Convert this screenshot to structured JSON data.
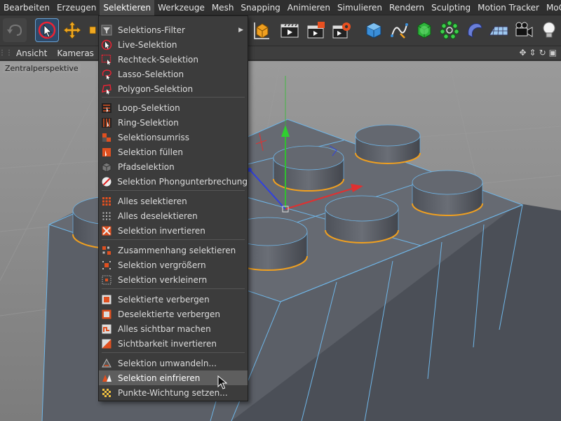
{
  "menubar": {
    "items": [
      "Bearbeiten",
      "Erzeugen",
      "Selektieren",
      "Werkzeuge",
      "Mesh",
      "Snapping",
      "Animieren",
      "Simulieren",
      "Rendern",
      "Sculpting",
      "Motion Tracker",
      "MoGraph"
    ],
    "active": "Selektieren"
  },
  "viewport": {
    "menus": [
      "Ansicht",
      "Kameras"
    ],
    "camera_label": "Zentralperspektive"
  },
  "dropdown": {
    "groups": [
      [
        "Selektions-Filter",
        "Live-Selektion",
        "Rechteck-Selektion",
        "Lasso-Selektion",
        "Polygon-Selektion"
      ],
      [
        "Loop-Selektion",
        "Ring-Selektion",
        "Selektionsumriss",
        "Selektion füllen",
        "Pfadselektion",
        "Selektion Phongunterbrechung"
      ],
      [
        "Alles selektieren",
        "Alles deselektieren",
        "Selektion invertieren"
      ],
      [
        "Zusammenhang selektieren",
        "Selektion vergrößern",
        "Selektion verkleinern"
      ],
      [
        "Selektierte verbergen",
        "Deselektierte verbergen",
        "Alles sichtbar machen",
        "Sichtbarkeit invertieren"
      ],
      [
        "Selektion umwandeln...",
        "Selektion einfrieren",
        "Punkte-Wichtung setzen..."
      ]
    ],
    "highlighted": "Selektion einfrieren",
    "submenu_item": "Selektions-Filter"
  },
  "colors": {
    "menubar_bg": "#2f2f2f",
    "dropdown_bg": "#3c3c3c",
    "highlight": "#5e5e5e",
    "viewport_bg": "#8a8a8a",
    "brick": "#5a5e66",
    "edge": "#6fb6e8",
    "selected_edge": "#f0a020"
  }
}
